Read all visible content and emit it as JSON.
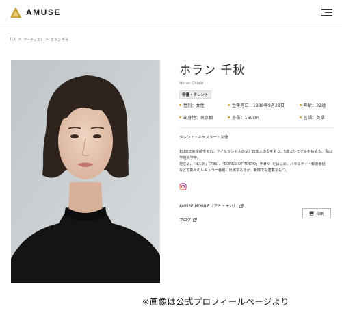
{
  "header": {
    "logo_text": "AMUSE",
    "brand_color": "#c9a233",
    "menu_icon": "hamburger-menu-icon"
  },
  "breadcrumb": {
    "items": [
      "TOP",
      ">",
      "アーティスト",
      ">",
      "ホラン 千秋"
    ]
  },
  "profile": {
    "name": "ホラン 千秋",
    "romaji": "Horan Chiaki",
    "badge": "俳優・タレント",
    "properties": [
      "性別：女性",
      "生年月日：1988年9月28日",
      "年齢：32歳",
      "出身地：東京都",
      "身長：160cm",
      "言語：英語"
    ],
    "category": "タレント・キャスター・女優",
    "bio": [
      "1988年東京都生まれ。アイルランド人の父と日本人の母をもつ。5歳よりモデルを始める。青山",
      "学院大学卒。",
      "現在は、「Nスタ」（TBS）、「SONGS OF TOKYO」（NHK）をはじめ、バラエティ・報道番組",
      "などで数々のレギュラー番組に出演するほか、新聞でも連載をもつ。"
    ],
    "instagram_icon": "instagram-icon",
    "links": {
      "mobile": "AMUSE MOBILE（アミュモバ）",
      "blog": "ブログ"
    },
    "print_label": "印刷"
  },
  "caption": "※画像は公式プロフィールページより"
}
